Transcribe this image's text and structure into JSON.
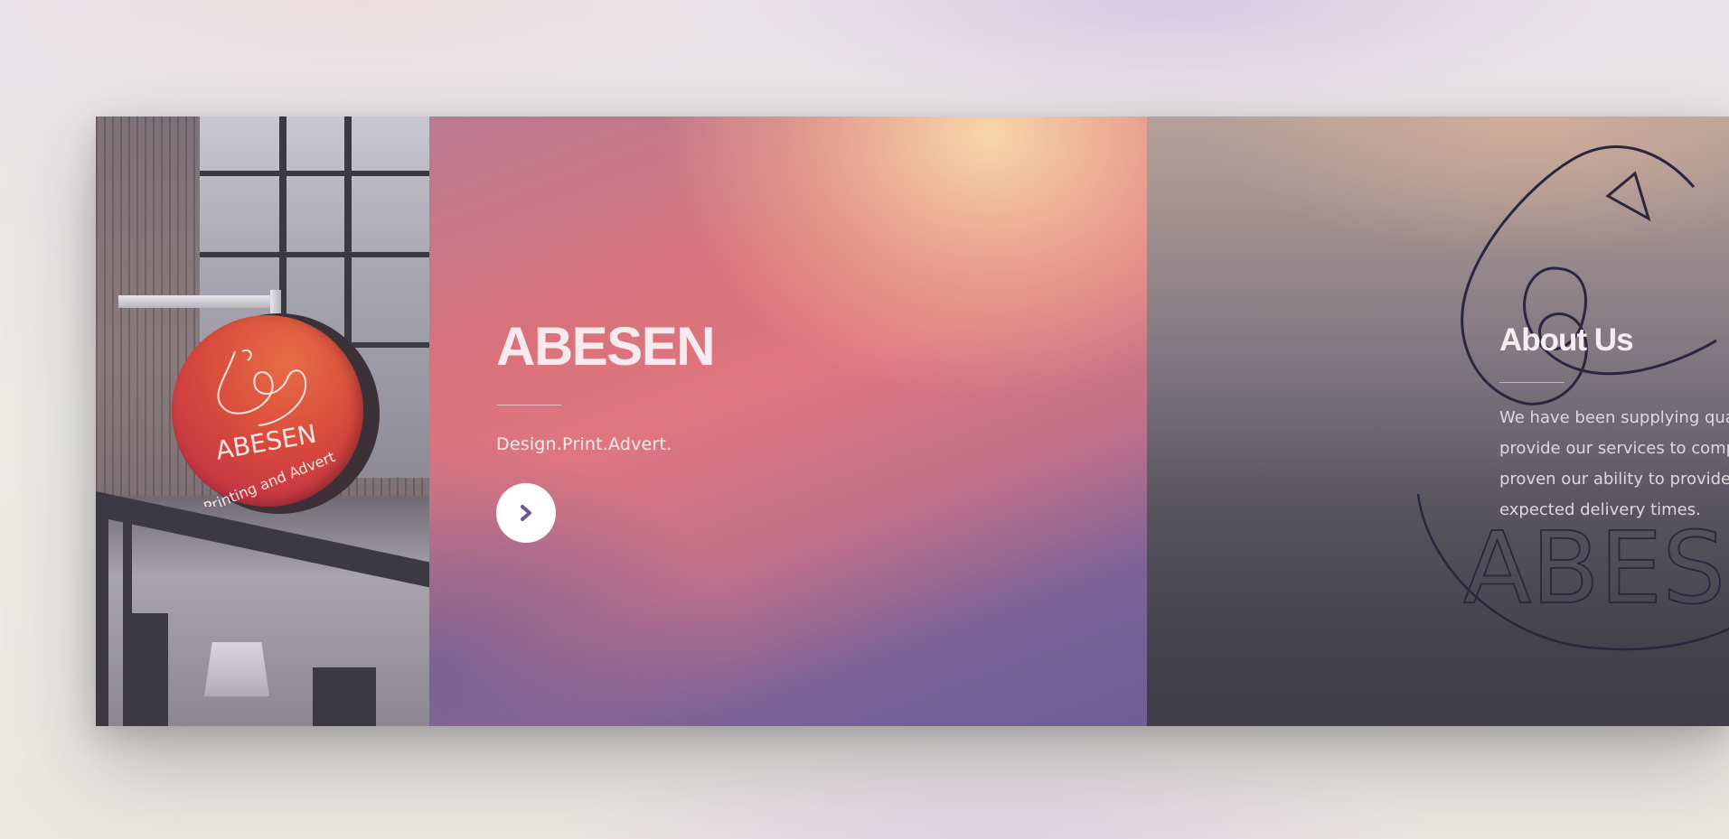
{
  "hero": {
    "title": "ABESEN",
    "tagline": "Design.Print.Advert.",
    "next_button_icon": "chevron-right-icon"
  },
  "sign": {
    "logo_text": "ABESEN",
    "subtitle": "Printing and Advert"
  },
  "about": {
    "title": "About Us",
    "lines": [
      "We have been supplying quali",
      "provide our services to compa",
      "proven our ability to provide q",
      "expected delivery times."
    ],
    "watermark_text": "ABESEN"
  },
  "colors": {
    "hero_peach": "#f6d7a8",
    "hero_coral": "#df7680",
    "hero_purple": "#6e5f96",
    "about_dark": "#3f3e49",
    "sign_orange": "#e76c45",
    "button": "#ffffff",
    "chevron": "#6a5a8a"
  }
}
